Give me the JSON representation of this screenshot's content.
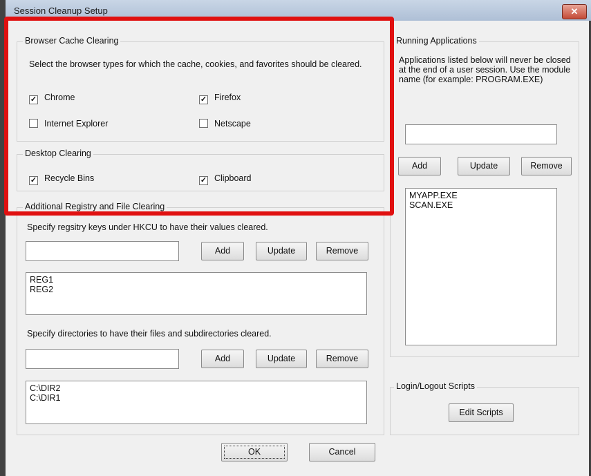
{
  "window": {
    "title": "Session Cleanup Setup",
    "close_label": "✕"
  },
  "browser": {
    "legend": "Browser Cache Clearing",
    "description": "Select the browser types for which the cache, cookies, and favorites should be cleared.",
    "items": [
      {
        "label": "Chrome",
        "checked": true
      },
      {
        "label": "Firefox",
        "checked": true
      },
      {
        "label": "Internet Explorer",
        "checked": false
      },
      {
        "label": "Netscape",
        "checked": false
      }
    ]
  },
  "desktop": {
    "legend": "Desktop Clearing",
    "items": [
      {
        "label": "Recycle Bins",
        "checked": true
      },
      {
        "label": "Clipboard",
        "checked": true
      }
    ]
  },
  "registry": {
    "legend": "Additional Registry and File Clearing",
    "reg_description": "Specify regsitry keys under HKCU to have their values cleared.",
    "reg_input_value": "",
    "reg_items": [
      "REG1",
      "REG2"
    ],
    "dir_description": "Specify directories to have their files and subdirectories cleared.",
    "dir_input_value": "",
    "dir_items": [
      "C:\\DIR2",
      "C:\\DIR1"
    ]
  },
  "running": {
    "legend": "Running Applications",
    "description": "Applications listed below will never be closed at the end of a user session. Use the module name (for example: PROGRAM.EXE)",
    "input_value": "",
    "items": [
      "MYAPP.EXE",
      "SCAN.EXE"
    ]
  },
  "scripts": {
    "legend": "Login/Logout Scripts",
    "edit_label": "Edit Scripts"
  },
  "buttons": {
    "add": "Add",
    "update": "Update",
    "remove": "Remove",
    "ok": "OK",
    "cancel": "Cancel"
  },
  "colors": {
    "highlight": "#e01010"
  }
}
